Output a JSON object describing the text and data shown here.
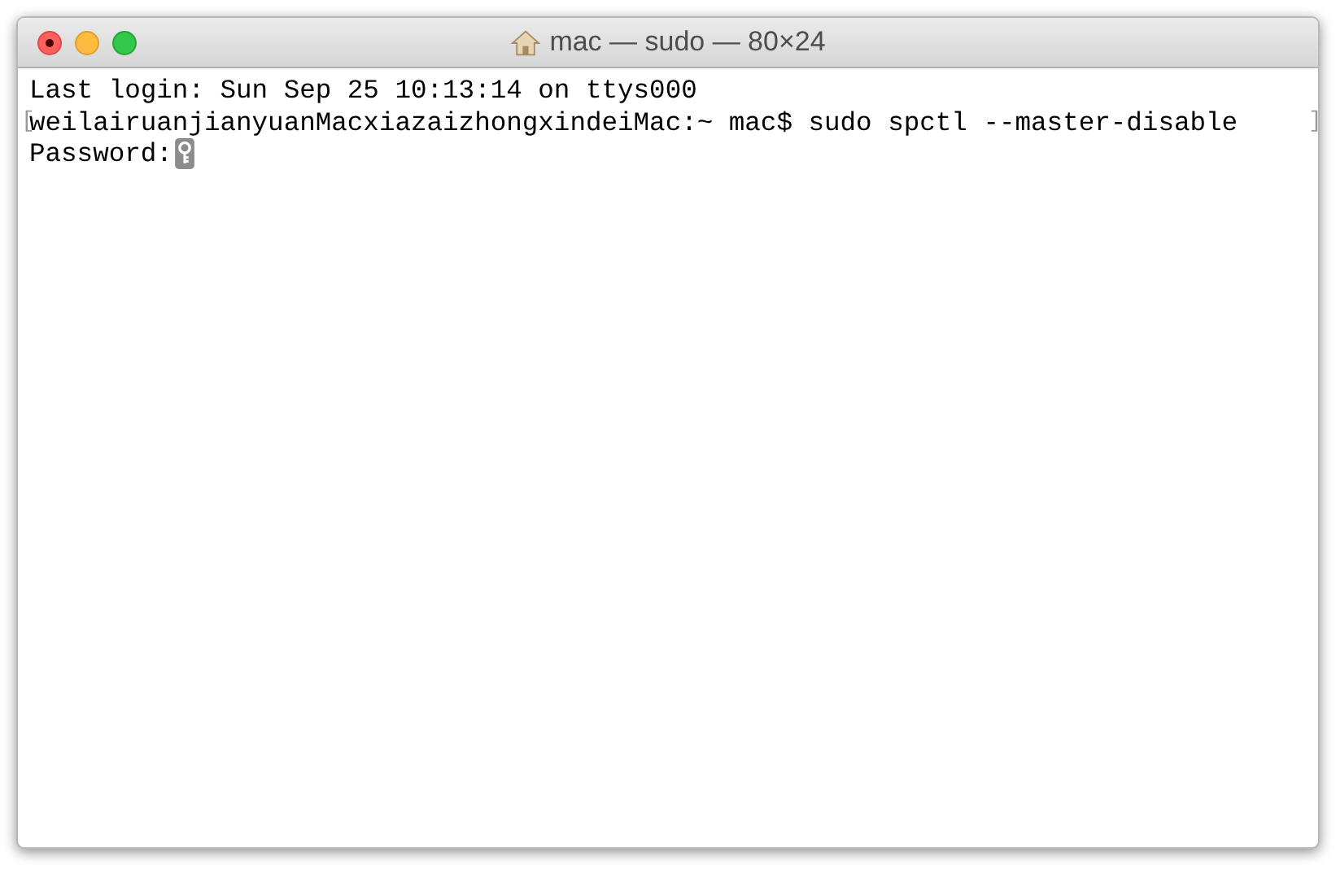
{
  "window": {
    "title": "mac — sudo — 80×24"
  },
  "lines": [
    {
      "kind": "output",
      "text": "Last login: Sun Sep 25 10:13:14 on ttys000"
    },
    {
      "kind": "prompt",
      "text": "weilairuanjianyuanMacxiazaizhongxindeiMac:~ mac$ sudo spctl --master-disable",
      "mark_open": "[",
      "mark_close": "]"
    },
    {
      "kind": "password",
      "text": "Password:"
    }
  ]
}
